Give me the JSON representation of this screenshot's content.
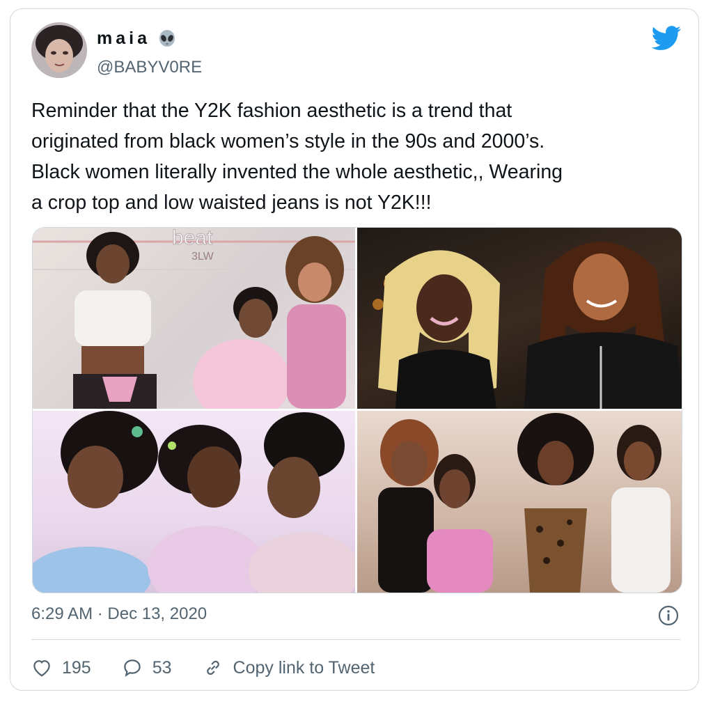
{
  "user": {
    "display_name": "maia",
    "handle": "@BABYV0RE",
    "emoji_icon": "alien-emoji-icon"
  },
  "tweet": {
    "text": "Reminder that the Y2K fashion aesthetic is a trend that\noriginated from black women’s style in the 90s and 2000’s.\nBlack women literally invented the whole aesthetic,, Wearing\na crop top and low waisted jeans is not Y2K!!!",
    "timestamp": "6:29 AM · Dec 13, 2020"
  },
  "media": {
    "photo_1_text": "beat",
    "photo_1_subtext": "3LW"
  },
  "actions": {
    "likes": "195",
    "replies": "53",
    "copy_link_label": "Copy link to Tweet"
  },
  "colors": {
    "twitter_blue": "#1d9bf0",
    "secondary_text": "#536471",
    "border": "#cfd9de"
  }
}
